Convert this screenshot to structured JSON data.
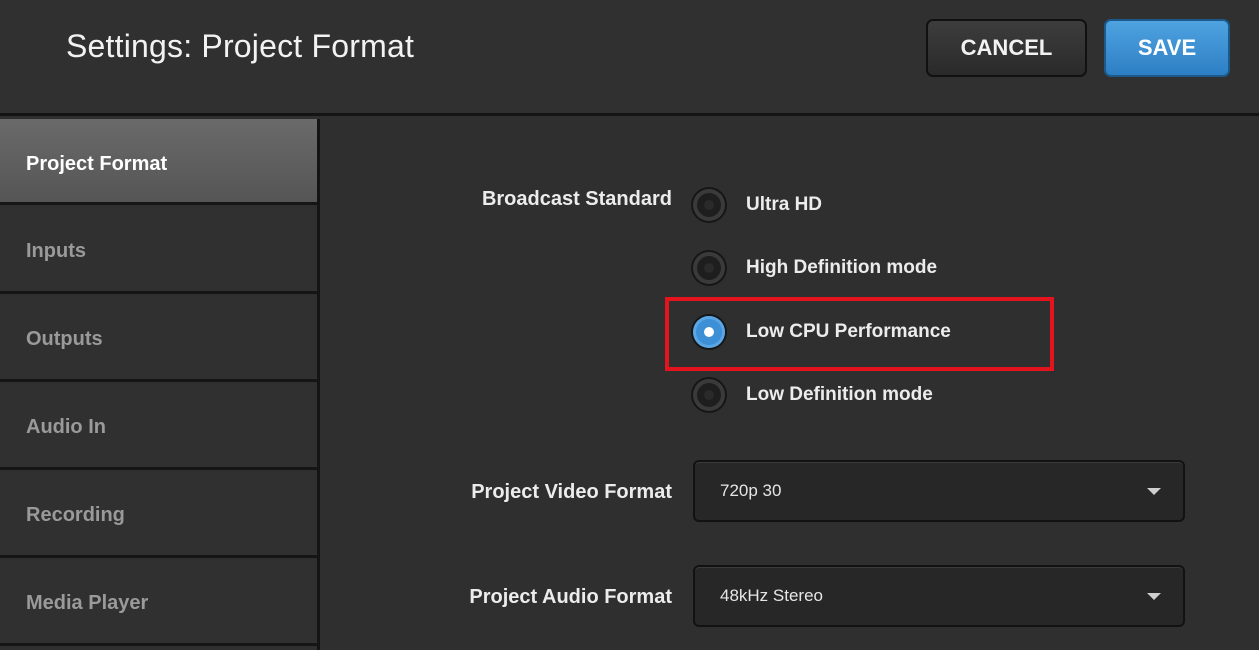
{
  "header": {
    "title": "Settings: Project Format",
    "cancel_label": "CANCEL",
    "save_label": "SAVE"
  },
  "sidebar": {
    "items": [
      {
        "label": "Project Format",
        "active": true
      },
      {
        "label": "Inputs",
        "active": false
      },
      {
        "label": "Outputs",
        "active": false
      },
      {
        "label": "Audio In",
        "active": false
      },
      {
        "label": "Recording",
        "active": false
      },
      {
        "label": "Media Player",
        "active": false
      }
    ]
  },
  "main": {
    "broadcast_standard": {
      "label": "Broadcast Standard",
      "options": [
        {
          "label": "Ultra HD",
          "selected": false
        },
        {
          "label": "High Definition mode",
          "selected": false
        },
        {
          "label": "Low CPU Performance",
          "selected": true
        },
        {
          "label": "Low Definition mode",
          "selected": false
        }
      ]
    },
    "video_format": {
      "label": "Project Video Format",
      "value": "720p 30"
    },
    "audio_format": {
      "label": "Project Audio Format",
      "value": "48kHz Stereo"
    }
  },
  "colors": {
    "accent": "#3d8fd6",
    "highlight_box": "#e3141e",
    "background": "#2f2f2f"
  }
}
